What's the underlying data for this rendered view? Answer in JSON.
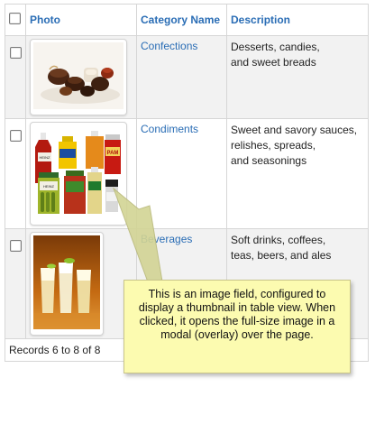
{
  "headers": {
    "photo": "Photo",
    "category": "Category Name",
    "description": "Description"
  },
  "rows": [
    {
      "category": "Confections",
      "description_lines": [
        "Desserts, candies,",
        "and sweet breads"
      ],
      "photo_icon": "chocolates-photo"
    },
    {
      "category": "Condiments",
      "description_lines": [
        "Sweet and savory sauces,",
        "relishes, spreads,",
        "and seasonings"
      ],
      "photo_icon": "condiment-bottles-photo"
    },
    {
      "category": "Beverages",
      "description_lines": [
        "Soft drinks, coffees,",
        "teas, beers, and ales"
      ],
      "photo_icon": "drinks-photo"
    }
  ],
  "footer": {
    "records": "Records 6 to 8 of 8"
  },
  "callout": {
    "text": "This is an image field, configured to display a thumbnail in table view. When clicked, it opens the full-size image in a modal (overlay) over the page."
  },
  "photo_labels": {
    "condiments": {
      "ketchup": "HEINZ",
      "spray": "PAM",
      "pickles": "HEINZ"
    }
  },
  "colors": {
    "link": "#2a6db5",
    "row_alt": "#f2f2f2",
    "callout_bg": "#fcfbb0",
    "arrow": "#c7c98a"
  }
}
